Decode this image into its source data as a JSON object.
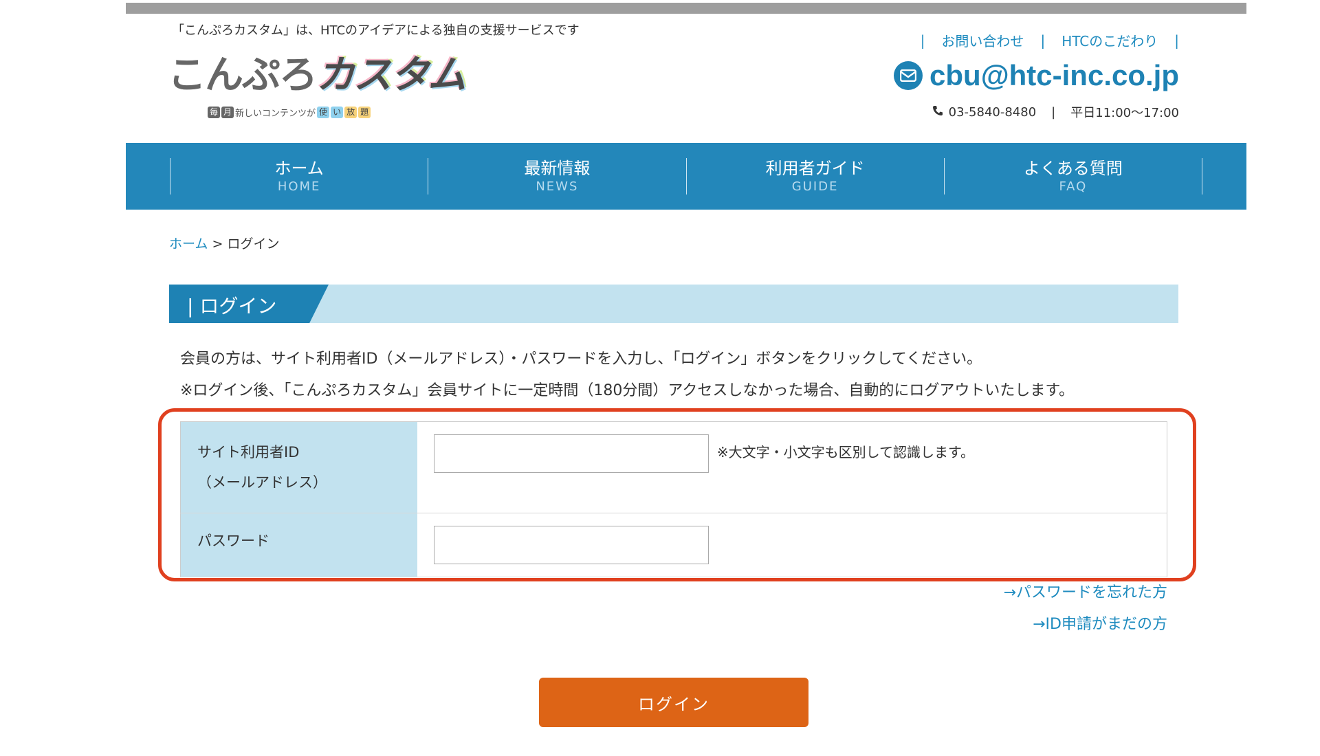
{
  "header": {
    "tagline": "「こんぷろカスタム」は、HTCのアイデアによる独自の支援サービスです",
    "logo": {
      "text_main": "こんぷろ",
      "text_accent": "カスタム",
      "sub_box1": "毎",
      "sub_box2": "月",
      "sub_text1": "新しいコンテンツが",
      "sub_box3": "使",
      "sub_box4": "い",
      "sub_box5": "放",
      "sub_box6": "題"
    },
    "links": [
      {
        "label": "お問い合わせ"
      },
      {
        "label": "HTCのこだわり"
      }
    ],
    "separator": "|",
    "email": "cbu@htc-inc.co.jp",
    "phone": "03-5840-8480",
    "hours": "平日11:00〜17:00"
  },
  "nav": [
    {
      "jp": "ホーム",
      "en": "HOME"
    },
    {
      "jp": "最新情報",
      "en": "NEWS"
    },
    {
      "jp": "利用者ガイド",
      "en": "GUIDE"
    },
    {
      "jp": "よくある質問",
      "en": "FAQ"
    }
  ],
  "breadcrumb": {
    "home": "ホーム",
    "sep": ">",
    "current": "ログイン"
  },
  "section": {
    "title": "ログイン"
  },
  "description": {
    "line1": "会員の方は、サイト利用者ID（メールアドレス）・パスワードを入力し、「ログイン」ボタンをクリックしてください。",
    "line2": "※ログイン後、「こんぷろカスタム」会員サイトに一定時間（180分間）アクセスしなかった場合、自動的にログアウトいたします。"
  },
  "form": {
    "id_label_line1": "サイト利用者ID",
    "id_label_line2": "（メールアドレス）",
    "id_value": "",
    "id_hint": "※大文字・小文字も区別して認識します。",
    "password_label": "パスワード",
    "password_value": ""
  },
  "links": {
    "forgot_password": "→パスワードを忘れた方",
    "no_id": "→ID申請がまだの方"
  },
  "login_button": "ログイン",
  "colors": {
    "brand_blue": "#2387ba",
    "light_blue": "#c2e2ef",
    "button_orange": "#dd6416",
    "highlight_red": "#e0401f"
  }
}
